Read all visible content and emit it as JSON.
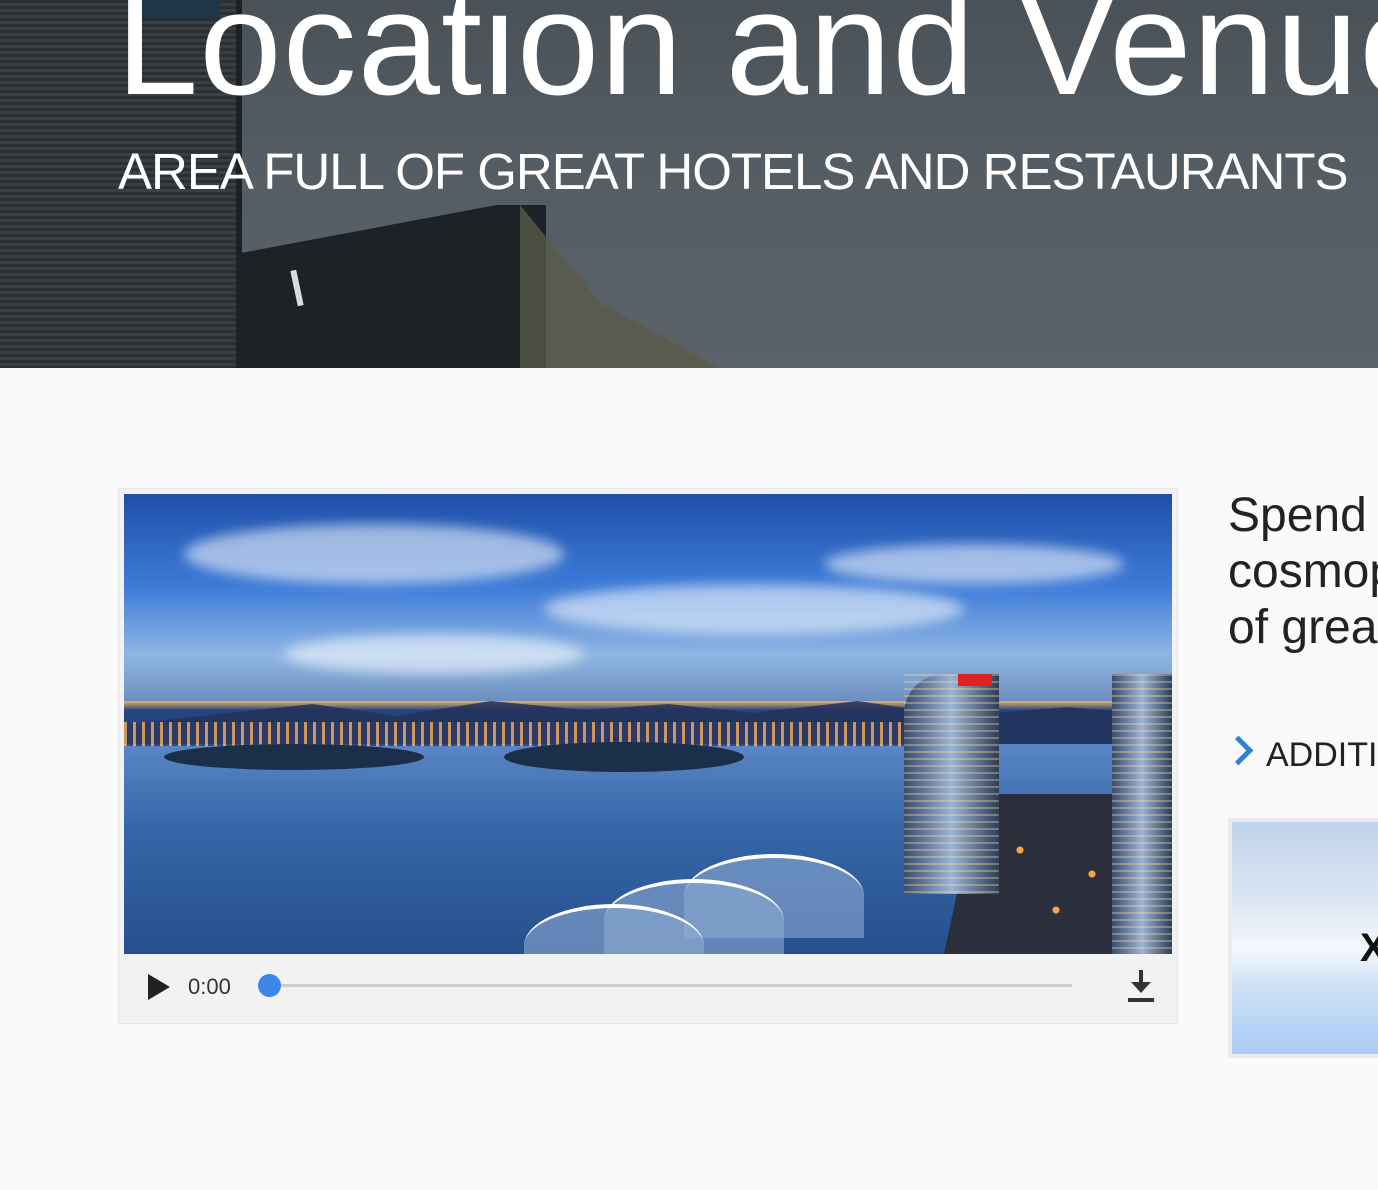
{
  "hero": {
    "title": "Location and Venue",
    "subtitle": "AREA FULL OF GREAT HOTELS AND RESTAURANTS"
  },
  "video": {
    "current_time": "0:00",
    "progress": 0,
    "play_icon": "play-icon",
    "download_icon": "download-icon"
  },
  "intro": {
    "text": "Spend \ncosmop\nof grea"
  },
  "more_link": {
    "label": "ADDITIO"
  },
  "promo": {
    "glyph": "X"
  },
  "colors": {
    "accent": "#2f7fd6",
    "progress": "#3d87e8"
  }
}
